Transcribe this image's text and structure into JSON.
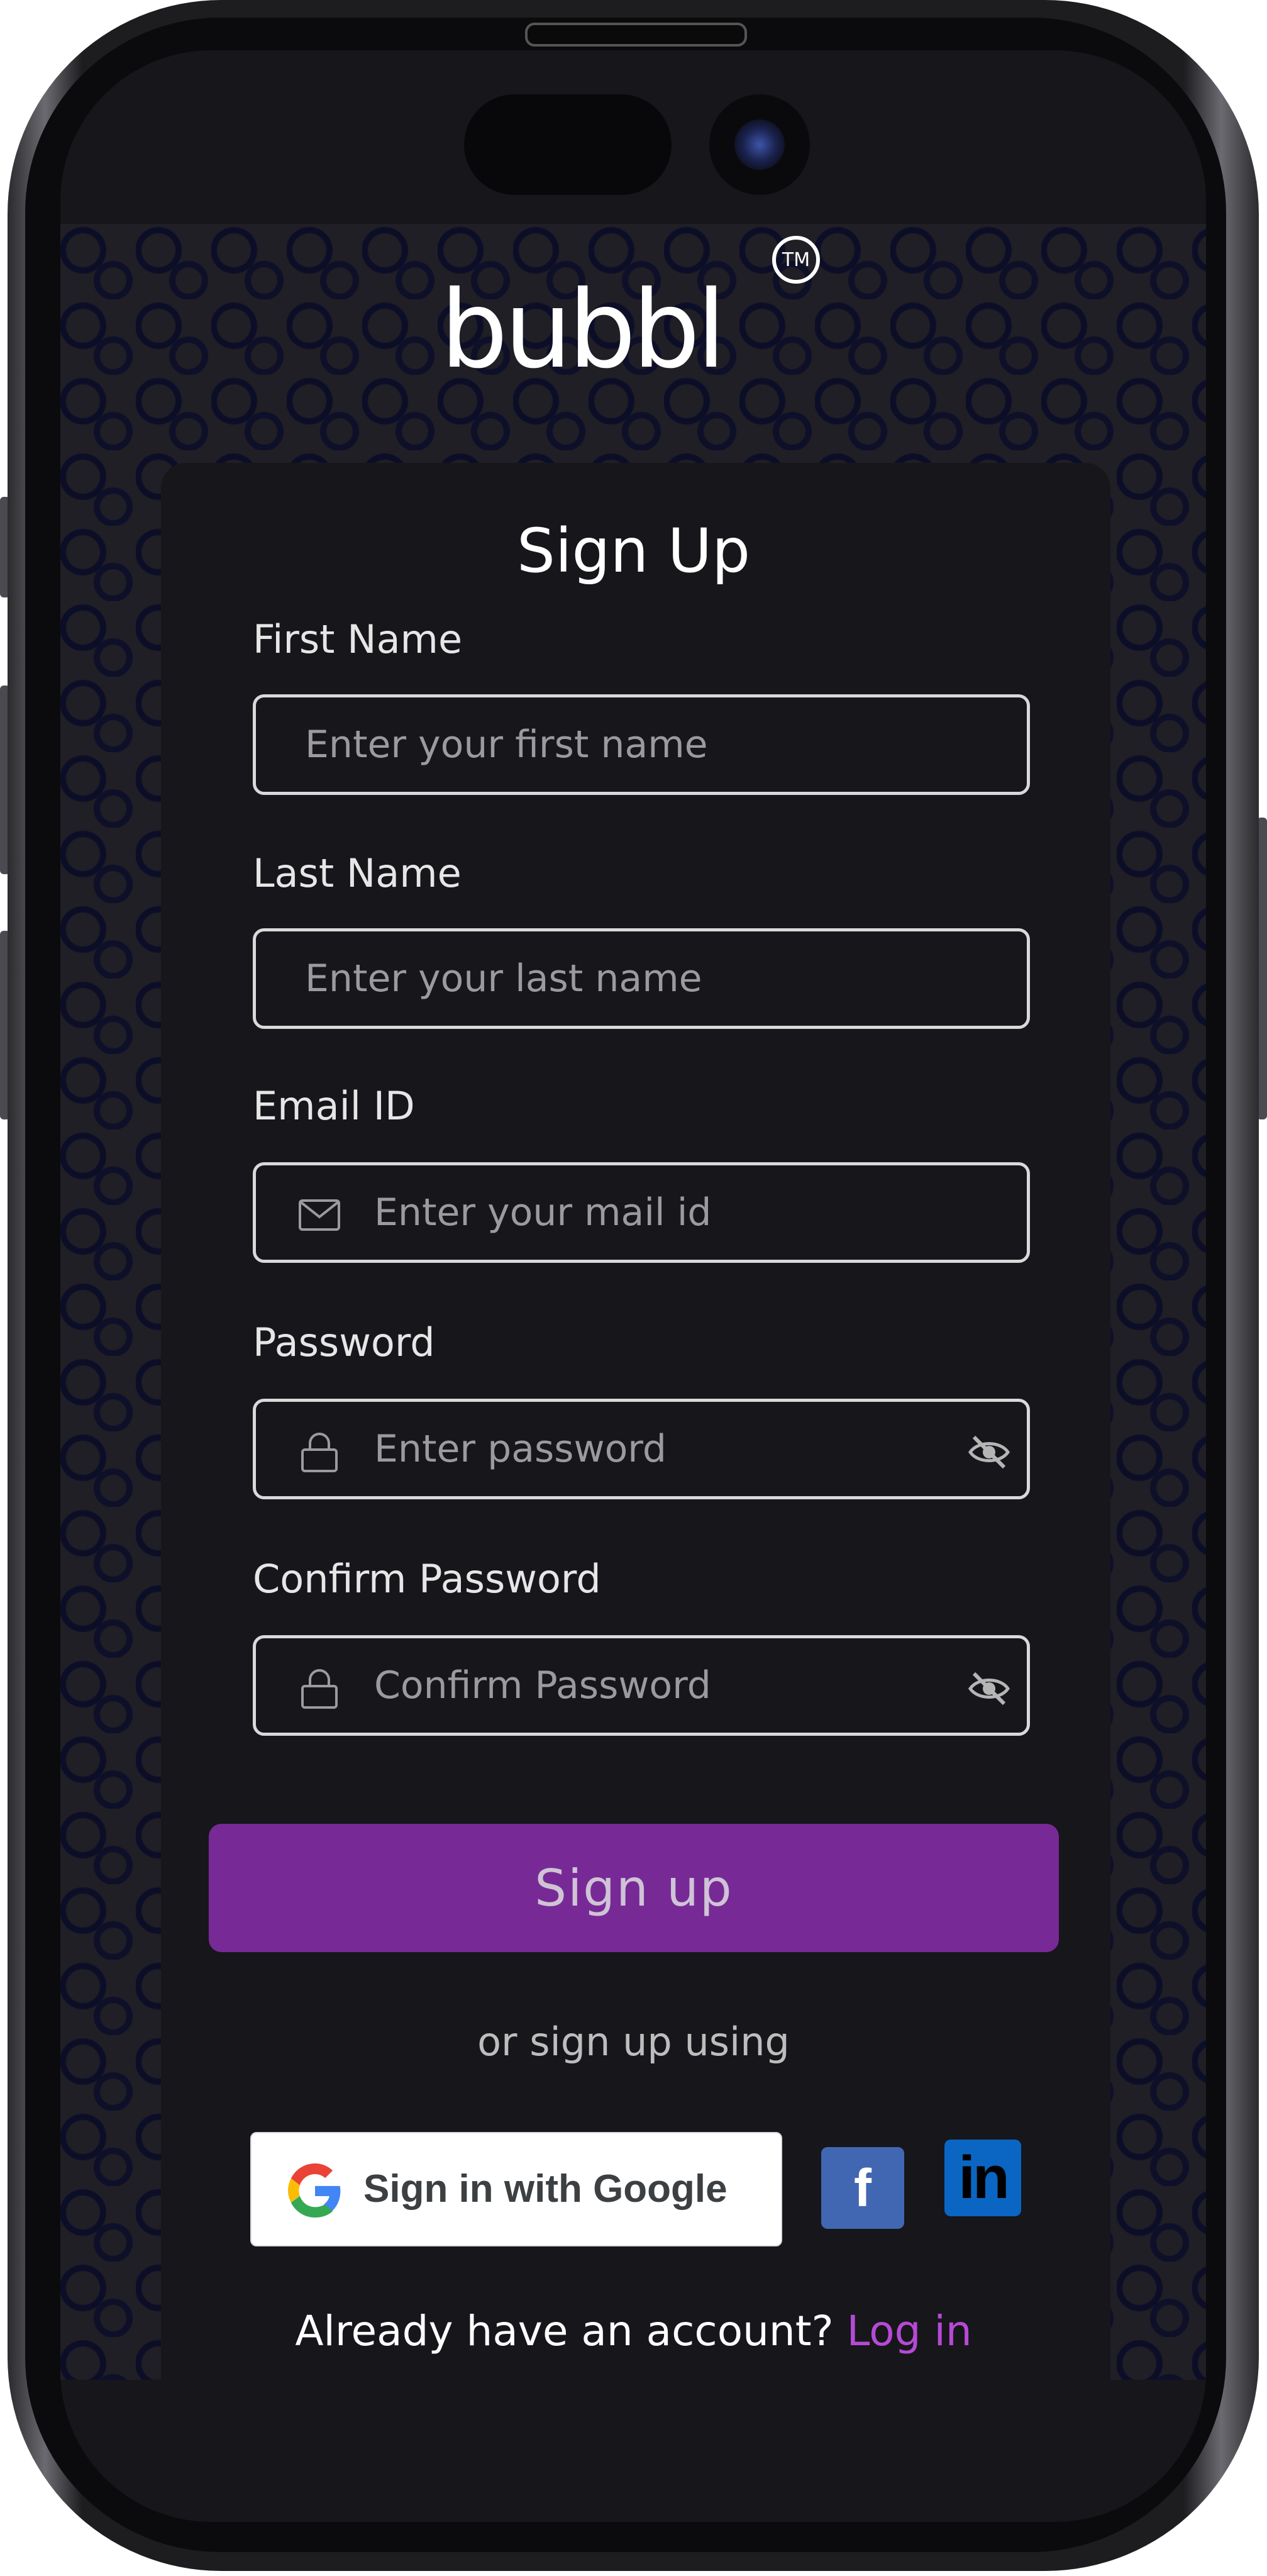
{
  "brand": {
    "logo_text": "bubbl",
    "trademark": "TM"
  },
  "form": {
    "title": "Sign Up",
    "first_name": {
      "label": "First Name",
      "placeholder": "Enter your first name",
      "value": ""
    },
    "last_name": {
      "label": "Last Name",
      "placeholder": "Enter your last name",
      "value": ""
    },
    "email": {
      "label": "Email ID",
      "placeholder": "Enter your mail id",
      "value": "",
      "icon": "mail-icon"
    },
    "password": {
      "label": "Password",
      "placeholder": "Enter password",
      "value": "",
      "icon": "lock-icon",
      "toggle_icon": "eye-off-icon"
    },
    "confirm_password": {
      "label": "Confirm Password",
      "placeholder": "Confirm Password",
      "value": "",
      "icon": "lock-icon",
      "toggle_icon": "eye-off-icon"
    },
    "submit_label": "Sign up"
  },
  "social": {
    "divider_text": "or sign up using",
    "google_label": "Sign in with Google",
    "facebook_glyph": "f",
    "linkedin_glyph": "in"
  },
  "footer": {
    "prompt": "Already have an account?",
    "link_label": "Log in"
  },
  "colors": {
    "accent": "#772a96",
    "link": "#b64ad6",
    "background": "#17161b",
    "facebook": "#4267b2",
    "linkedin": "#0a66c2"
  }
}
